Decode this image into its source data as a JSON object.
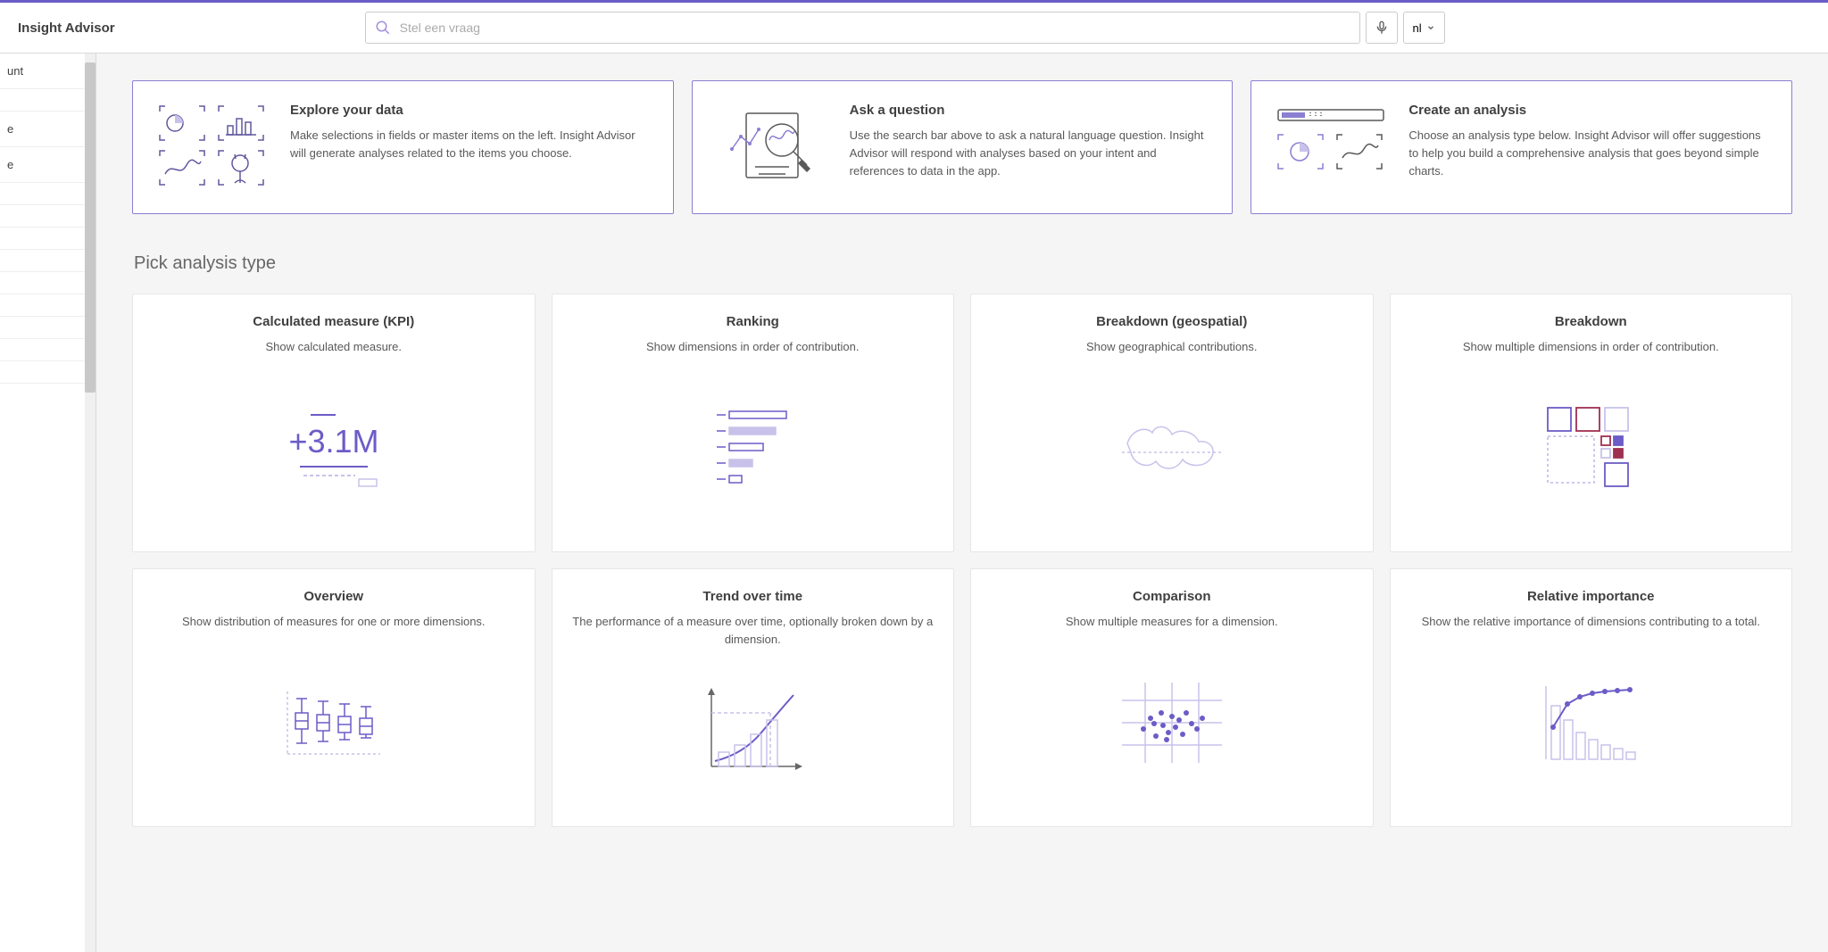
{
  "header": {
    "title": "Insight Advisor",
    "search_placeholder": "Stel een vraag",
    "lang": "nl"
  },
  "sidebar": {
    "items": [
      "unt",
      "",
      "e",
      "e",
      "",
      "",
      "",
      "",
      "",
      "",
      "",
      "",
      ""
    ]
  },
  "hero": {
    "explore": {
      "title": "Explore your data",
      "desc": "Make selections in fields or master items on the left. Insight Advisor will generate analyses related to the items you choose."
    },
    "ask": {
      "title": "Ask a question",
      "desc": "Use the search bar above to ask a natural language question. Insight Advisor will respond with analyses based on your intent and references to data in the app."
    },
    "create": {
      "title": "Create an analysis",
      "desc": "Choose an analysis type below. Insight Advisor will offer suggestions to help you build a comprehensive analysis that goes beyond simple charts."
    }
  },
  "section_title": "Pick analysis type",
  "tiles": [
    {
      "title": "Calculated measure (KPI)",
      "desc": "Show calculated measure.",
      "art": "kpi"
    },
    {
      "title": "Ranking",
      "desc": "Show dimensions in order of contribution.",
      "art": "ranking"
    },
    {
      "title": "Breakdown (geospatial)",
      "desc": "Show geographical contributions.",
      "art": "geo"
    },
    {
      "title": "Breakdown",
      "desc": "Show multiple dimensions in order of contribution.",
      "art": "treemap"
    },
    {
      "title": "Overview",
      "desc": "Show distribution of measures for one or more dimensions.",
      "art": "boxplot"
    },
    {
      "title": "Trend over time",
      "desc": "The performance of a measure over time, optionally broken down by a dimension.",
      "art": "trend"
    },
    {
      "title": "Comparison",
      "desc": "Show multiple measures for a dimension.",
      "art": "scatter"
    },
    {
      "title": "Relative importance",
      "desc": "Show the relative importance of dimensions contributing to a total.",
      "art": "pareto"
    }
  ]
}
